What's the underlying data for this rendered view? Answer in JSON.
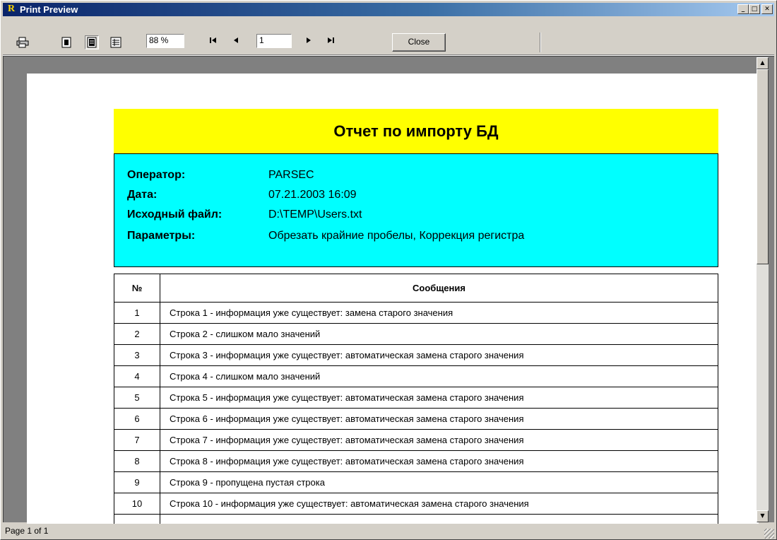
{
  "window": {
    "title": "Print Preview",
    "icon": "R",
    "caption_buttons": {
      "minimize": "_",
      "maximize": "□",
      "close": "✕"
    }
  },
  "toolbar": {
    "zoom_value": "88 %",
    "page_value": "1",
    "close_label": "Close"
  },
  "report": {
    "title": "Отчет по импорту БД",
    "info": [
      {
        "label": "Оператор:",
        "value": "PARSEC"
      },
      {
        "label": "Дата:",
        "value": "07.21.2003 16:09"
      },
      {
        "label": "Исходный файл:",
        "value": "D:\\TEMP\\Users.txt"
      },
      {
        "label": "Параметры:",
        "value": "Обрезать крайние пробелы, Коррекция регистра"
      }
    ],
    "table": {
      "headers": [
        "№",
        "Сообщения"
      ],
      "rows": [
        {
          "num": "1",
          "msg": "Строка 1 - информация уже существует: замена старого значения"
        },
        {
          "num": "2",
          "msg": "Строка 2 - слишком мало значений"
        },
        {
          "num": "3",
          "msg": "Строка 3 - информация уже существует: автоматическая замена старого значения"
        },
        {
          "num": "4",
          "msg": "Строка 4 - слишком мало значений"
        },
        {
          "num": "5",
          "msg": "Строка 5 - информация уже существует: автоматическая замена старого значения"
        },
        {
          "num": "6",
          "msg": "Строка 6 - информация уже существует: автоматическая замена старого значения"
        },
        {
          "num": "7",
          "msg": "Строка 7 - информация уже существует: автоматическая замена старого значения"
        },
        {
          "num": "8",
          "msg": "Строка 8 - информация уже существует: автоматическая замена старого значения"
        },
        {
          "num": "9",
          "msg": "Строка 9 - пропущена пустая строка"
        },
        {
          "num": "10",
          "msg": "Строка 10 - информация уже существует: автоматическая замена старого значения"
        }
      ]
    }
  },
  "status": {
    "text": "Page 1 of 1"
  },
  "colors": {
    "title_band": "#ffff00",
    "info_band": "#00ffff",
    "titlebar_start": "#0a246a"
  }
}
